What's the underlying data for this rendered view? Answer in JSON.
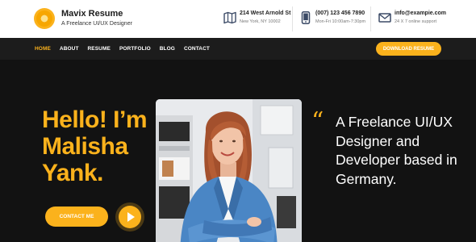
{
  "brand": {
    "name": "Mavix Resume",
    "tagline": "A Freelance UI/UX Designer",
    "logo_icon": "sun-logo-icon"
  },
  "contacts": [
    {
      "icon": "map-icon",
      "line1": "214 West Arnold St",
      "line2": "New York, NY 10002"
    },
    {
      "icon": "phone-icon",
      "line1": "(007) 123 456 7890",
      "line2": "Mon-Fri 10:00am-7:30pm"
    },
    {
      "icon": "mail-icon",
      "line1": "info@exampie.com",
      "line2": "24 X 7 online support"
    }
  ],
  "nav": {
    "items": [
      "HOME",
      "ABOUT",
      "RESUME",
      "PORTFOLIO",
      "BLOG",
      "CONTACT"
    ],
    "active": "HOME",
    "download_label": "DOWNLOAD RESUME"
  },
  "hero": {
    "greeting_lines": [
      "Hello! I’m",
      "Malisha",
      "Yank."
    ],
    "contact_button": "CONTACT ME",
    "play_icon": "play-icon",
    "quote_icon": "quote-icon",
    "quote_glyph": "“",
    "intro_text": "A Freelance UI/UX Designer and Developer based in Germany."
  },
  "colors": {
    "accent": "#fbb21c",
    "header_bg": "#ffffff",
    "nav_bg": "#1c1c1c",
    "hero_bg": "#121212",
    "icon": "#3b4a66"
  }
}
